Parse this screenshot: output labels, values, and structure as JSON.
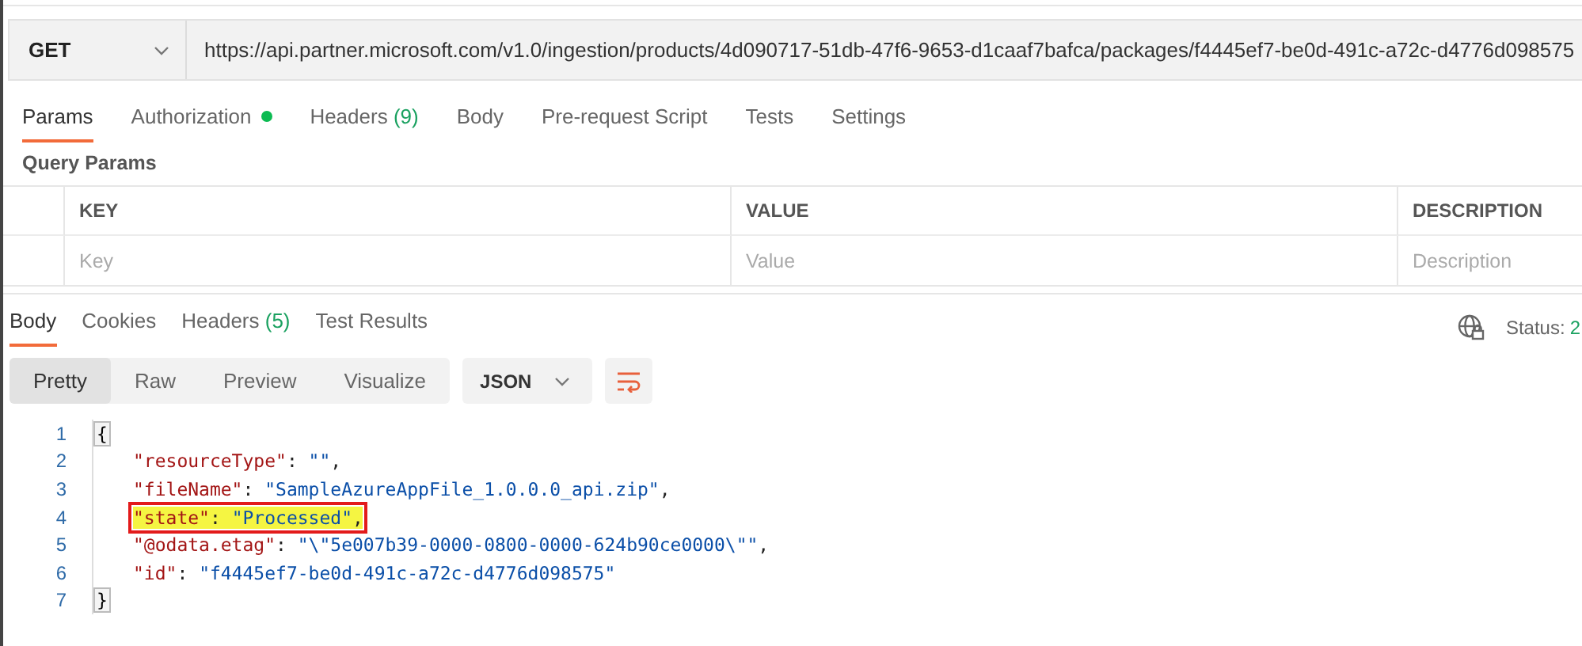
{
  "request": {
    "method": "GET",
    "url": "https://api.partner.microsoft.com/v1.0/ingestion/products/4d090717-51db-47f6-9653-d1caaf7bafca/packages/f4445ef7-be0d-491c-a72c-d4776d098575"
  },
  "request_tabs": [
    {
      "label": "Params",
      "selected": true
    },
    {
      "label": "Authorization",
      "selected": false,
      "color": "#0cbb52"
    },
    {
      "label": "Headers",
      "count": "(9)",
      "selected": false
    },
    {
      "label": "Body",
      "selected": false
    },
    {
      "label": "Pre-request Script",
      "selected": false
    },
    {
      "label": "Tests",
      "selected": false
    },
    {
      "label": "Settings",
      "selected": false
    }
  ],
  "query_params": {
    "title": "Query Params",
    "columns": [
      "KEY",
      "VALUE",
      "DESCRIPTION"
    ],
    "placeholders": [
      "Key",
      "Value",
      "Description"
    ]
  },
  "response_tabs": [
    {
      "label": "Body",
      "selected": true
    },
    {
      "label": "Cookies",
      "selected": false
    },
    {
      "label": "Headers",
      "count": "(5)",
      "selected": false
    },
    {
      "label": "Test Results",
      "selected": false
    }
  ],
  "status": {
    "label": "Status:",
    "value": "2"
  },
  "view_modes": [
    {
      "label": "Pretty",
      "selected": true
    },
    {
      "label": "Raw",
      "selected": false
    },
    {
      "label": "Preview",
      "selected": false
    },
    {
      "label": "Visualize",
      "selected": false
    }
  ],
  "format": "JSON",
  "code_lines": [
    {
      "number": "1",
      "kind": "brace",
      "text": "{"
    },
    {
      "number": "2",
      "kind": "pair",
      "key": "\"resourceType\"",
      "sep": ": ",
      "value": "\"\"",
      "trail": ",",
      "highlighted": false
    },
    {
      "number": "3",
      "kind": "pair",
      "key": "\"fileName\"",
      "sep": ": ",
      "value": "\"SampleAzureAppFile_1.0.0.0_api.zip\"",
      "trail": ",",
      "highlighted": false
    },
    {
      "number": "4",
      "kind": "pair",
      "key": "\"state\"",
      "sep": ": ",
      "value": "\"Processed\"",
      "trail": ",",
      "highlighted": true
    },
    {
      "number": "5",
      "kind": "pair",
      "key": "\"@odata.etag\"",
      "sep": ": ",
      "value": "\"\\\"5e007b39-0000-0800-0000-624b90ce0000\\\"\"",
      "trail": ",",
      "highlighted": false
    },
    {
      "number": "6",
      "kind": "pair",
      "key": "\"id\"",
      "sep": ": ",
      "value": "\"f4445ef7-be0d-491c-a72c-d4776d098575\"",
      "highlighted": false
    },
    {
      "number": "7",
      "kind": "brace",
      "text": "}"
    }
  ]
}
